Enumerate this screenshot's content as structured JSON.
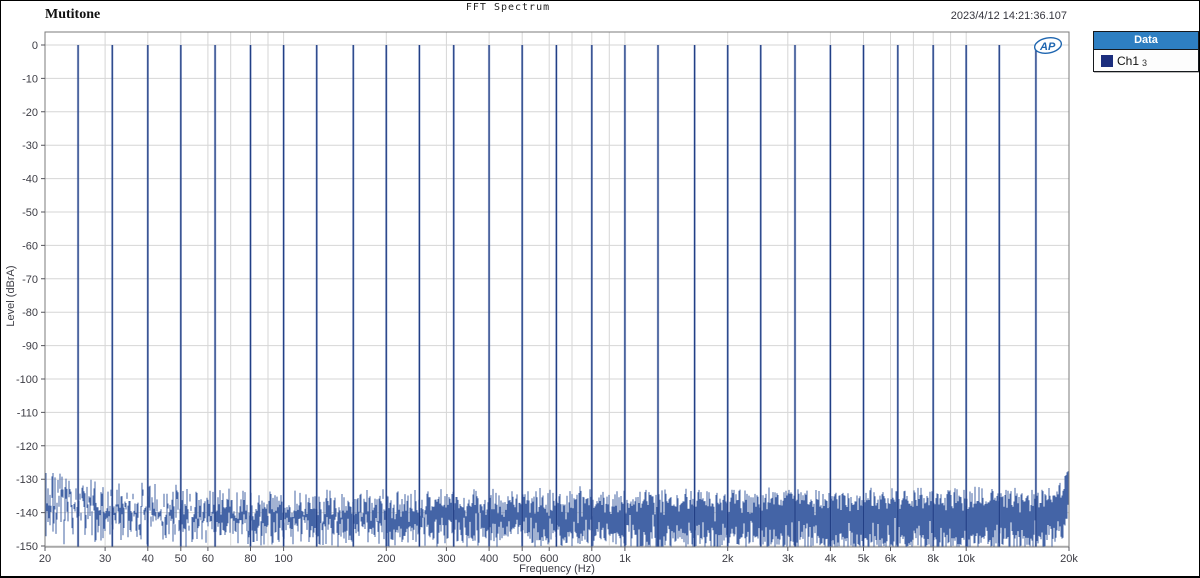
{
  "header": {
    "label_left": "Mutitone",
    "title": "FFT Spectrum",
    "timestamp": "2023/4/12 14:21:36.107"
  },
  "legend": {
    "header": "Data",
    "entries": [
      {
        "label": "Ch1",
        "sub": "3",
        "swatch_color": "#1b2d7d"
      }
    ]
  },
  "logo": {
    "text": "AP"
  },
  "colors": {
    "trace_halo": "#5572b3",
    "trace_core": "#223f85",
    "noise": "#4464a6",
    "grid": "#d6d6d6",
    "frame": "#7b7b7b",
    "tick": "#55555c",
    "text": "#3c3c44",
    "legend_header_bg": "#2e7fc2",
    "logo_blue": "#1f66b0"
  },
  "chart_data": {
    "type": "line",
    "title": "FFT Spectrum",
    "xlabel": "Frequency (Hz)",
    "ylabel": "Level (dBrA)",
    "x_scale": "log",
    "xlim": [
      20,
      20000
    ],
    "ylim": [
      -150,
      0
    ],
    "grid": true,
    "legend_position": "outside-top-right",
    "y_ticks": [
      0,
      -10,
      -20,
      -30,
      -40,
      -50,
      -60,
      -70,
      -80,
      -90,
      -100,
      -110,
      -120,
      -130,
      -140,
      -150
    ],
    "x_ticks": [
      {
        "value": 20,
        "label": "20"
      },
      {
        "value": 30,
        "label": "30"
      },
      {
        "value": 40,
        "label": "40"
      },
      {
        "value": 50,
        "label": "50"
      },
      {
        "value": 60,
        "label": "60"
      },
      {
        "value": 80,
        "label": "80"
      },
      {
        "value": 100,
        "label": "100"
      },
      {
        "value": 200,
        "label": "200"
      },
      {
        "value": 300,
        "label": "300"
      },
      {
        "value": 400,
        "label": "400"
      },
      {
        "value": 500,
        "label": "500"
      },
      {
        "value": 600,
        "label": "600"
      },
      {
        "value": 800,
        "label": "800"
      },
      {
        "value": 1000,
        "label": "1k"
      },
      {
        "value": 2000,
        "label": "2k"
      },
      {
        "value": 3000,
        "label": "3k"
      },
      {
        "value": 4000,
        "label": "4k"
      },
      {
        "value": 5000,
        "label": "5k"
      },
      {
        "value": 6000,
        "label": "6k"
      },
      {
        "value": 8000,
        "label": "8k"
      },
      {
        "value": 10000,
        "label": "10k"
      },
      {
        "value": 20000,
        "label": "20k"
      }
    ],
    "x_grid_values": [
      20,
      30,
      40,
      50,
      60,
      70,
      80,
      90,
      100,
      200,
      300,
      400,
      500,
      600,
      700,
      800,
      900,
      1000,
      2000,
      3000,
      4000,
      5000,
      6000,
      7000,
      8000,
      9000,
      10000,
      20000
    ],
    "series": [
      {
        "name": "Ch1 3",
        "tones_hz": [
          25,
          31.5,
          40,
          50,
          63,
          80,
          100,
          125,
          160,
          200,
          250,
          315,
          400,
          500,
          630,
          800,
          1000,
          1250,
          1600,
          2000,
          2500,
          3150,
          4000,
          5000,
          6300,
          8000,
          10000,
          12500,
          16000
        ],
        "tone_level_dB": 0,
        "noise_floor": {
          "mean_dB": -140,
          "left_edge_mean_dB": -134,
          "right_edge_mean_dB": -136,
          "peak_dB": -128,
          "min_dB": -150
        }
      }
    ],
    "noise_seed": 7
  }
}
